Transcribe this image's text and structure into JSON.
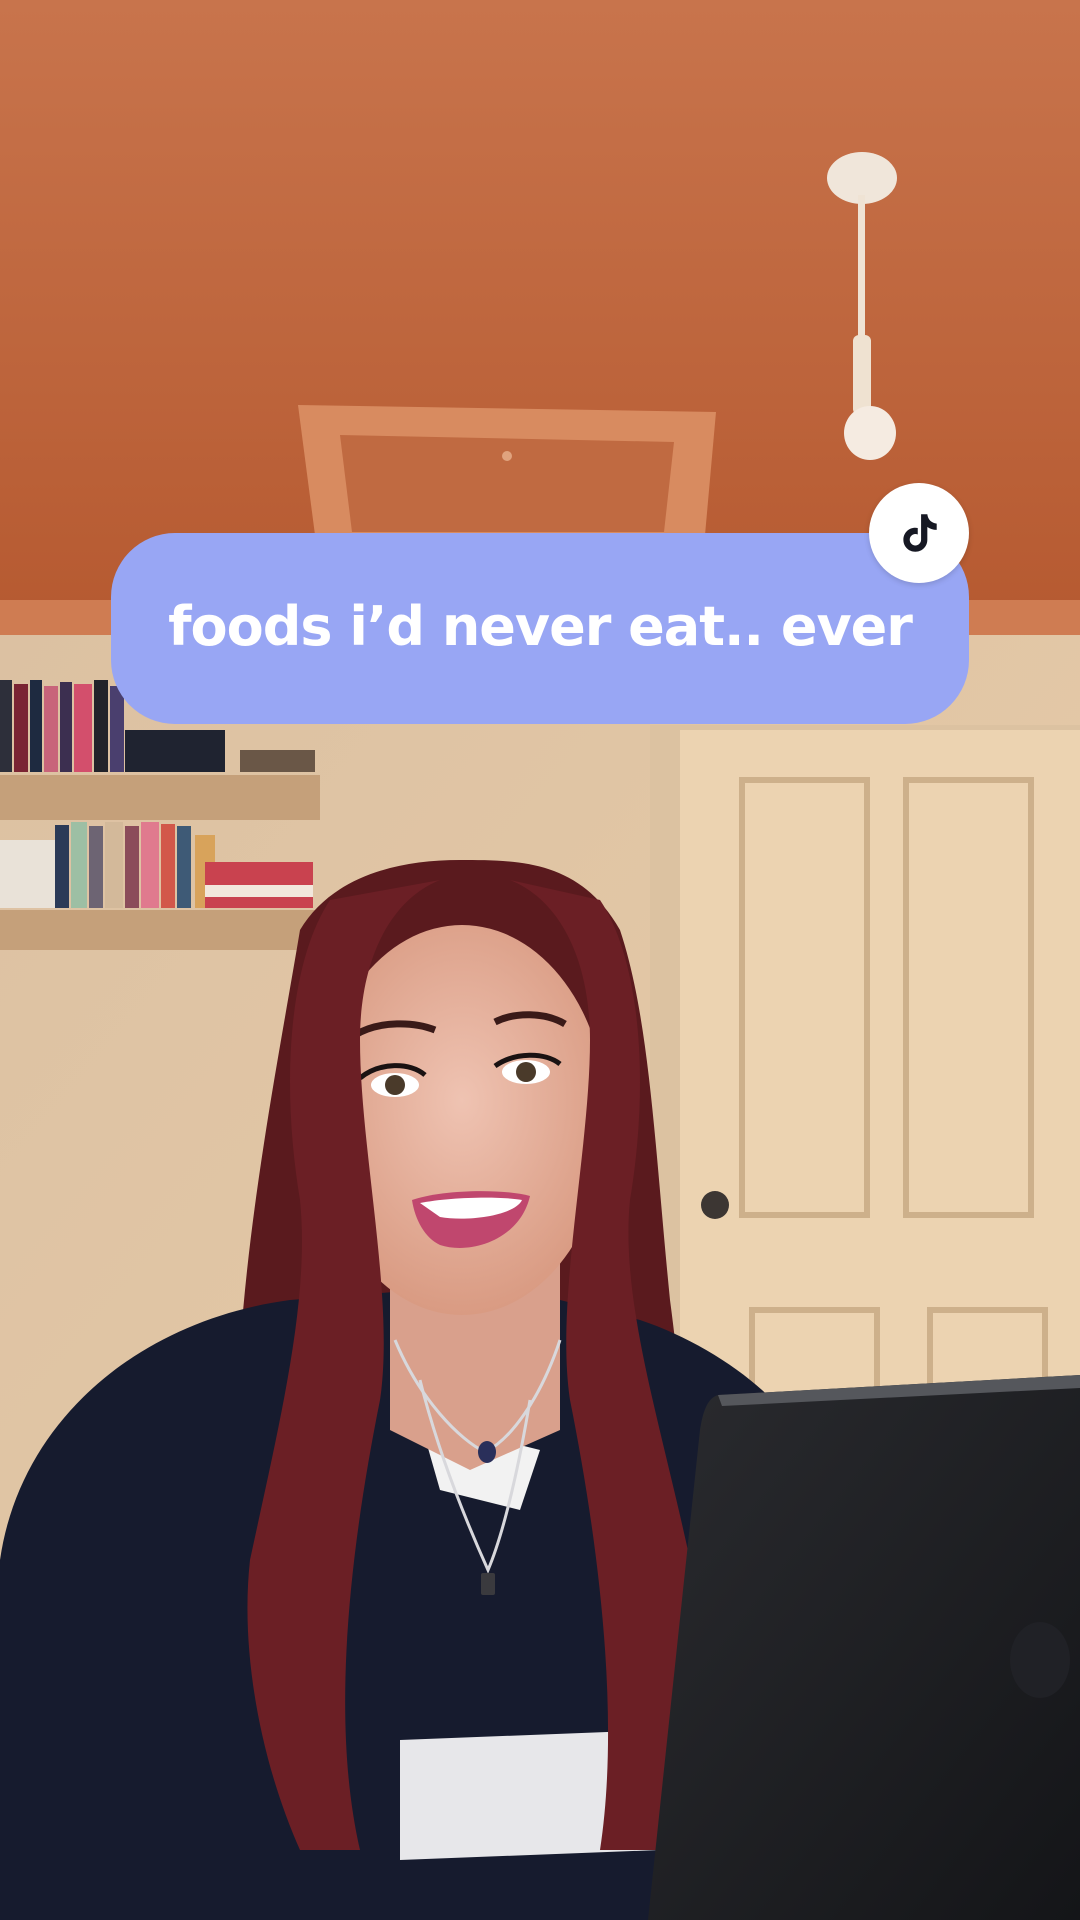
{
  "caption": {
    "text": "foods i’d never eat.. ever",
    "background_color": "#98a6f4",
    "text_color": "#ffffff"
  },
  "badge": {
    "icon": "tiktok-logo-icon",
    "background_color": "#ffffff",
    "icon_color": "#161823"
  },
  "scene": {
    "description_colors": {
      "ceiling": "#c66f46",
      "wall": "#e3c7a4",
      "door": "#ebd0ad",
      "hair": "#5a1a1e",
      "jersey": "#161b2e",
      "laptop": "#1c1d20"
    }
  }
}
